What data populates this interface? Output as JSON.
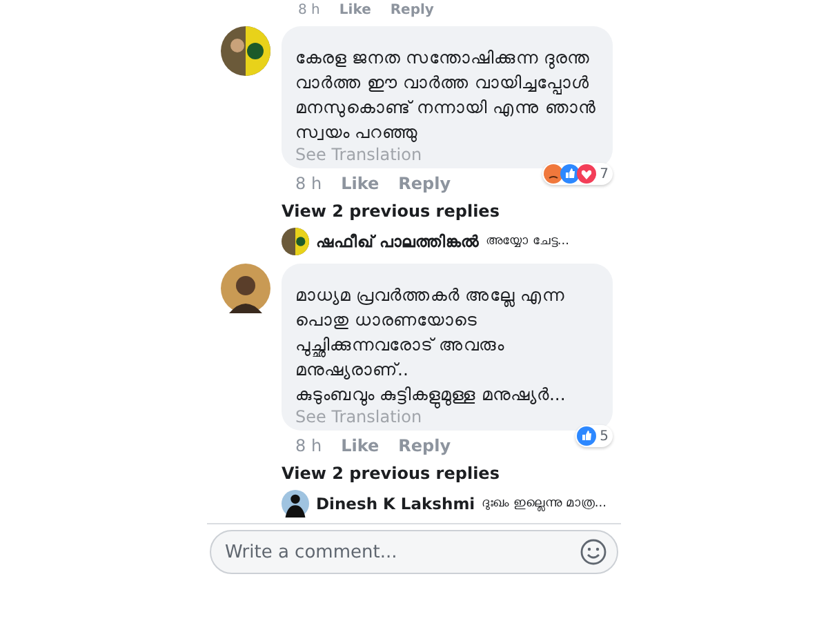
{
  "top_actions": {
    "time": "8 h",
    "like": "Like",
    "reply": "Reply"
  },
  "comments": [
    {
      "avatar": {
        "kind": "badge"
      },
      "text": "കേരള ജനത സന്തോഷിക്കുന്ന ദുരന്ത\nവാർത്ത ഈ വാർത്ത വായിച്ചപ്പോൾ\nമനസുകൊണ്ട് നന്നായി എന്നു ഞാൻ\nസ്വയം പറഞ്ഞു",
      "translation": "See Translation",
      "time": "8 h",
      "like": "Like",
      "reply": "Reply",
      "reactions": [
        {
          "kind": "angry"
        },
        {
          "kind": "like"
        },
        {
          "kind": "love"
        }
      ],
      "reaction_count": "7",
      "view_replies": "View 2 previous replies",
      "last_reply": {
        "avatar": {
          "kind": "badge"
        },
        "name": "ഷഫീഖ് പാലത്തിങ്കൽ",
        "text": "അയ്യോ ചേട്ട..."
      }
    },
    {
      "avatar": {
        "kind": "person"
      },
      "text": "മാധ്യമ പ്രവർത്തകർ അല്ലേ എന്ന\nപൊതു ധാരണയോടെ\nപുച്ഛിക്കുന്നവരോട്   അവരും\nമനുഷ്യരാണ്..\nകുടുംബവും  കുട്ടികളുമുള്ള മനുഷ്യർ...",
      "translation": "See Translation",
      "time": "8 h",
      "like": "Like",
      "reply": "Reply",
      "reactions": [
        {
          "kind": "like"
        }
      ],
      "reaction_count": "5",
      "view_replies": "View 2 previous replies",
      "last_reply": {
        "avatar": {
          "kind": "silhouette"
        },
        "name": "Dinesh K Lakshmi",
        "text": "ദുഃഖം ഇല്ലെന്നു മാത്ര..."
      }
    }
  ],
  "composer": {
    "placeholder": "Write a comment..."
  }
}
